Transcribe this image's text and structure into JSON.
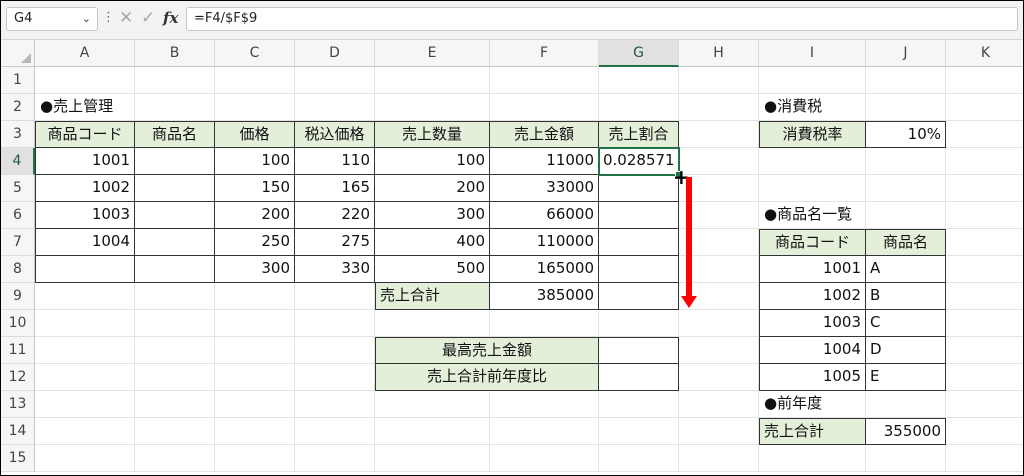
{
  "formula_bar": {
    "name_box": "G4",
    "formula": "=F4/$F$9",
    "more_icon": "vertical-ellipsis",
    "cancel_icon": "x-mark",
    "enter_icon": "check-mark",
    "fx_label": "fx"
  },
  "columns": [
    "A",
    "B",
    "C",
    "D",
    "E",
    "F",
    "G",
    "H",
    "I",
    "J",
    "K"
  ],
  "rows": [
    "1",
    "2",
    "3",
    "4",
    "5",
    "6",
    "7",
    "8",
    "9",
    "10",
    "11",
    "12",
    "13",
    "14",
    "15"
  ],
  "selected_cell": "G4",
  "accent_color": "#217346",
  "header_fill_color": "#e3efd9",
  "arrow_color": "#ff0000",
  "sales": {
    "title": "●売上管理",
    "headers": [
      "商品コード",
      "商品名",
      "価格",
      "税込価格",
      "売上数量",
      "売上金額",
      "売上割合"
    ],
    "rows": [
      [
        "1001",
        "",
        "100",
        "110",
        "100",
        "11000",
        "0.028571"
      ],
      [
        "1002",
        "",
        "150",
        "165",
        "200",
        "33000",
        ""
      ],
      [
        "1003",
        "",
        "200",
        "220",
        "300",
        "66000",
        ""
      ],
      [
        "1004",
        "",
        "250",
        "275",
        "400",
        "110000",
        ""
      ],
      [
        "",
        "",
        "300",
        "330",
        "500",
        "165000",
        ""
      ]
    ],
    "total_label": "売上合計",
    "total_value": "385000",
    "total_extra": ""
  },
  "summary": {
    "rows": [
      {
        "label": "最高売上金額",
        "value": ""
      },
      {
        "label": "売上合計前年度比",
        "value": ""
      }
    ]
  },
  "tax": {
    "title": "●消費税",
    "label": "消費税率",
    "value": "10%"
  },
  "product_list": {
    "title": "●商品名一覧",
    "headers": [
      "商品コード",
      "商品名"
    ],
    "rows": [
      [
        "1001",
        "A"
      ],
      [
        "1002",
        "B"
      ],
      [
        "1003",
        "C"
      ],
      [
        "1004",
        "D"
      ],
      [
        "1005",
        "E"
      ]
    ]
  },
  "previous_year": {
    "title": "●前年度",
    "label": "売上合計",
    "value": "355000"
  }
}
